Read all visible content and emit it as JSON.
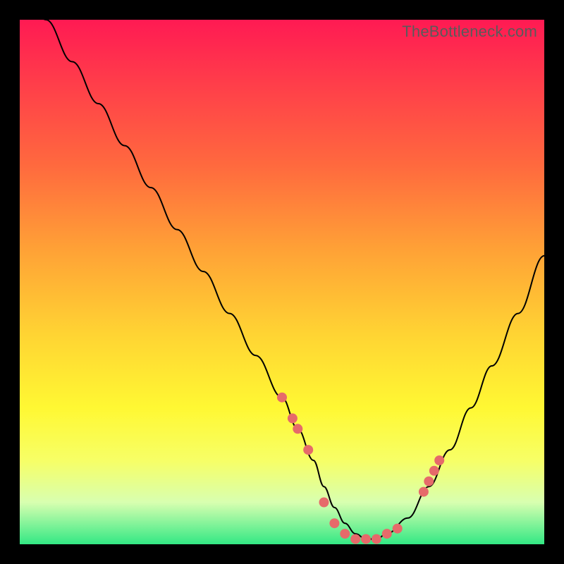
{
  "watermark": "TheBottleneck.com",
  "chart_data": {
    "type": "line",
    "title": "",
    "xlabel": "",
    "ylabel": "",
    "xlim": [
      0,
      100
    ],
    "ylim": [
      0,
      100
    ],
    "grid": false,
    "series": [
      {
        "name": "bottleneck-curve",
        "x": [
          0,
          5,
          10,
          15,
          20,
          25,
          30,
          35,
          40,
          45,
          50,
          53,
          56,
          58,
          60,
          62,
          64,
          66,
          68,
          70,
          74,
          78,
          82,
          86,
          90,
          95,
          100
        ],
        "y": [
          108,
          100,
          92,
          84,
          76,
          68,
          60,
          52,
          44,
          36,
          28,
          22,
          16,
          11,
          7,
          4,
          2,
          1,
          1,
          2,
          5,
          11,
          18,
          26,
          34,
          44,
          55
        ]
      }
    ],
    "markers": {
      "name": "highlight-points",
      "x": [
        50,
        52,
        53,
        55,
        58,
        60,
        62,
        64,
        66,
        68,
        70,
        72,
        77,
        78,
        79,
        80
      ],
      "y": [
        28,
        24,
        22,
        18,
        8,
        4,
        2,
        1,
        1,
        1,
        2,
        3,
        10,
        12,
        14,
        16
      ]
    },
    "colors": {
      "curve": "#000000",
      "markers": "#e66a6a",
      "gradient_top": "#ff1a53",
      "gradient_mid": "#fff833",
      "gradient_bottom": "#33e884"
    }
  }
}
